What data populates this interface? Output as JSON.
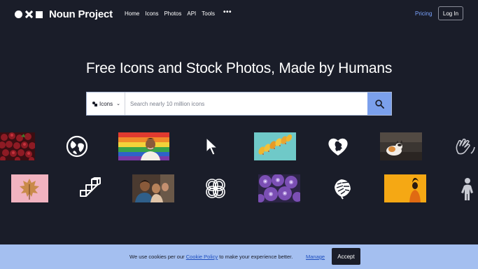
{
  "header": {
    "brand": "Noun Project",
    "nav": [
      "Home",
      "Icons",
      "Photos",
      "API",
      "Tools"
    ],
    "more": "•••",
    "pricing": "Pricing",
    "login": "Log In"
  },
  "hero": {
    "headline": "Free Icons and Stock Photos, Made by Humans"
  },
  "search": {
    "type_label": "Icons",
    "placeholder": "Search nearly 10 million icons",
    "value": ""
  },
  "gallery": {
    "row1": [
      "strawberries-photo",
      "globe-icon",
      "rainbow-flag-portrait-photo",
      "cursor-arrow-icon",
      "yellow-leaves-photo",
      "heart-face-icon",
      "cat-photo",
      "hands-icon"
    ],
    "row2": [
      "autumn-leaf-photo",
      "cubes-icon",
      "family-photo",
      "loop-knot-icon",
      "purple-flowers-photo",
      "monstera-leaf-icon",
      "yellow-portrait-photo",
      "person-icon"
    ]
  },
  "cookie": {
    "text_before": "We use cookies per our ",
    "link": "Cookie Policy",
    "text_after": " to make your experience better.",
    "manage": "Manage",
    "accept": "Accept"
  },
  "colors": {
    "background": "#1a1d29",
    "accent": "#7ba0ec",
    "cookie_bg": "#a4bff0"
  }
}
